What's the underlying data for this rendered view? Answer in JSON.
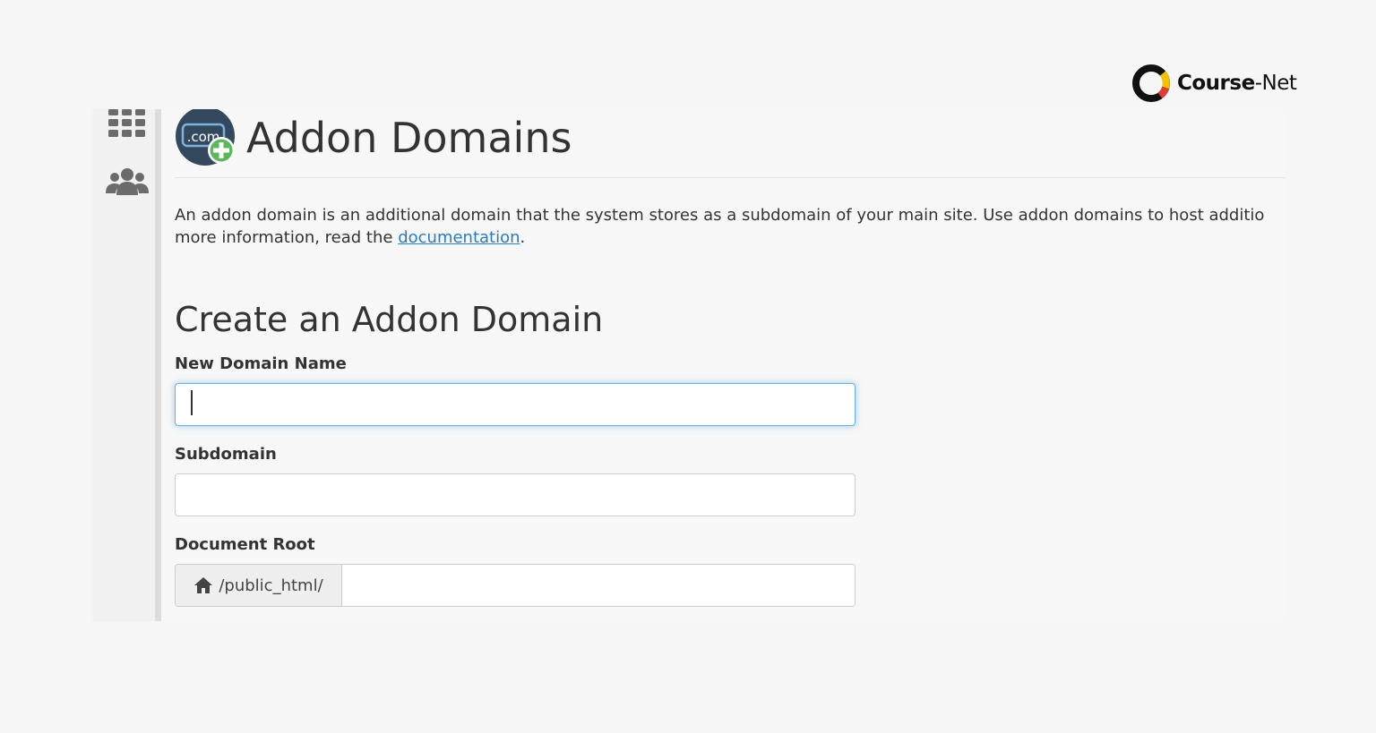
{
  "brand": {
    "name_bold": "Course",
    "name_rest": "-Net"
  },
  "app_icon_text": ".com",
  "page": {
    "title": "Addon Domains",
    "intro_text": "An addon domain is an additional domain that the system stores as a subdomain of your main site. Use addon domains to host additio",
    "intro_line2_prefix": "more information, read the ",
    "intro_link": "documentation",
    "intro_line2_suffix": "."
  },
  "form": {
    "section_title": "Create an Addon Domain",
    "new_domain": {
      "label": "New Domain Name",
      "value": ""
    },
    "subdomain": {
      "label": "Subdomain",
      "value": ""
    },
    "document_root": {
      "label": "Document Root",
      "prefix": "/public_html/",
      "value": ""
    }
  },
  "colors": {
    "accent_link": "#2a7bbf",
    "focus_ring": "#66afe9",
    "icon_dark": "#34495e",
    "icon_plus": "#5cb85c"
  }
}
